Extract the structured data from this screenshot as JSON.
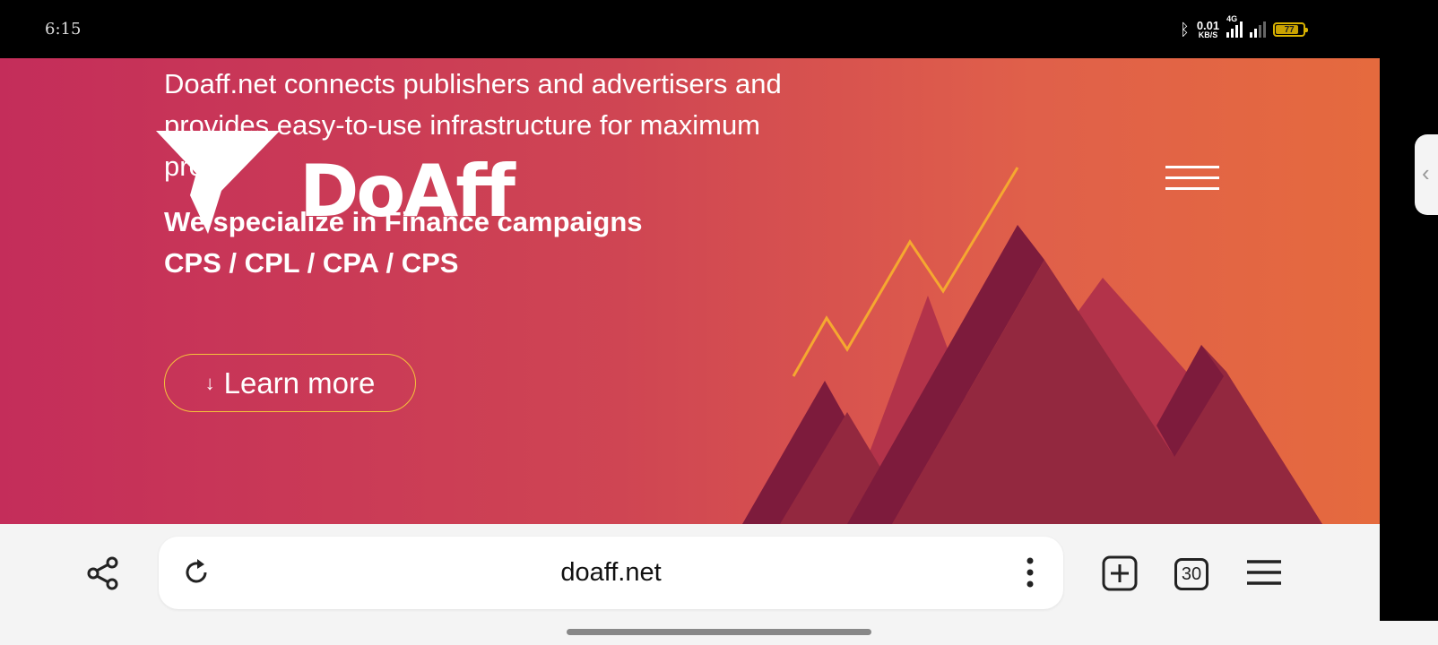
{
  "status_bar": {
    "time": "6:15",
    "net_speed": "0.01",
    "net_unit": "KB/S",
    "network_type": "4G",
    "battery": "77",
    "battery_level": 0.77,
    "icons": [
      "bluetooth-icon",
      "signal-icon",
      "signal-weak-icon",
      "battery-icon"
    ]
  },
  "hero": {
    "logo_text": "DoAff",
    "description": "Doaff.net connects publishers and advertisers and provides easy-to-use infrastructure for maximum profit.",
    "specialty_line1": "We specialize in Finance campaigns",
    "specialty_line2": "CPS / CPL / CPA / CPS",
    "learn_more_arrow": "↓",
    "learn_more_label": "Learn more",
    "colors": {
      "gradient_start": "#c42d5a",
      "gradient_end": "#e56a3e",
      "accent_line": "#f5a830",
      "mountain_dark": "#7d1b3c"
    }
  },
  "browser": {
    "url": "doaff.net",
    "tab_count": "30",
    "icons": [
      "share-icon",
      "reload-icon",
      "more-vertical-icon",
      "new-tab-icon",
      "tabs-icon",
      "menu-icon"
    ]
  }
}
